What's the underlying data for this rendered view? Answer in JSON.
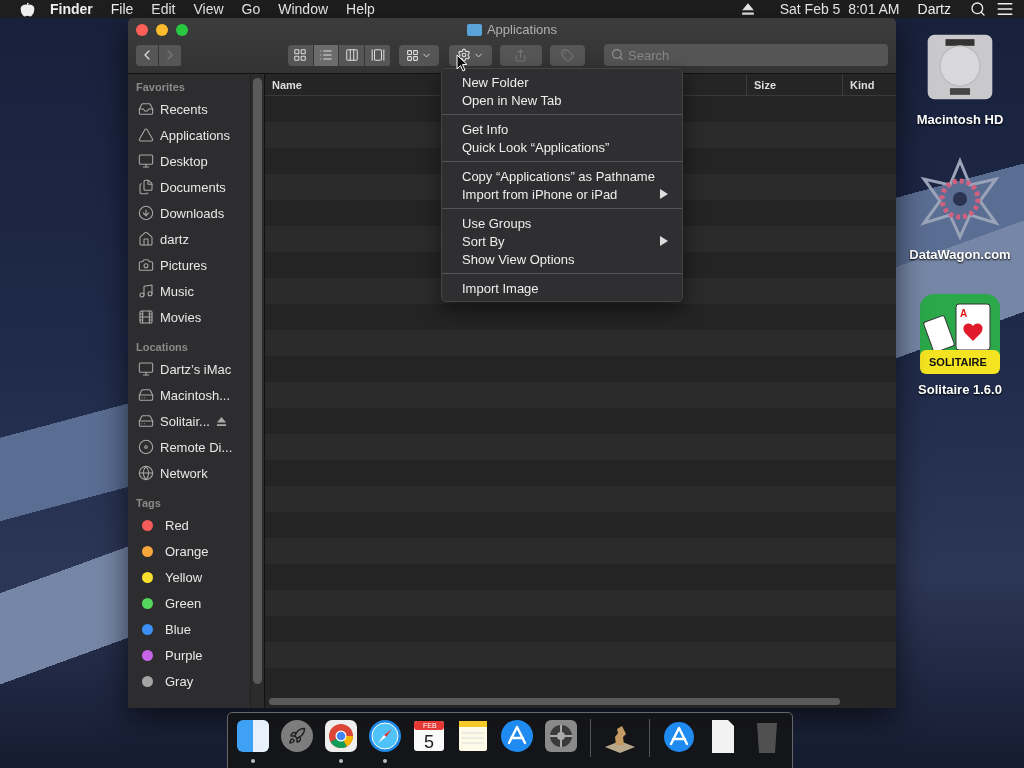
{
  "menubar": {
    "app": "Finder",
    "menus": [
      "File",
      "Edit",
      "View",
      "Go",
      "Window",
      "Help"
    ],
    "clock": "Sat Feb 5  8:01 AM",
    "user": "Dartz"
  },
  "window": {
    "title": "Applications",
    "toolbar": {
      "views": [
        {
          "kind": "icons",
          "selected": false
        },
        {
          "kind": "list",
          "selected": true
        },
        {
          "kind": "columns",
          "selected": false
        },
        {
          "kind": "gallery",
          "selected": false
        }
      ],
      "share_disabled": true,
      "tags_disabled": true,
      "search": {
        "placeholder": "Search"
      }
    },
    "sidebar": [
      {
        "heading": "Favorites",
        "items": [
          {
            "label": "Recents",
            "kind": "recents"
          },
          {
            "label": "Applications",
            "kind": "applications"
          },
          {
            "label": "Desktop",
            "kind": "desktop"
          },
          {
            "label": "Documents",
            "kind": "documents"
          },
          {
            "label": "Downloads",
            "kind": "downloads"
          },
          {
            "label": "dartz",
            "kind": "home"
          },
          {
            "label": "Pictures",
            "kind": "pictures"
          },
          {
            "label": "Music",
            "kind": "music"
          },
          {
            "label": "Movies",
            "kind": "movies"
          }
        ]
      },
      {
        "heading": "Locations",
        "items": [
          {
            "label": "Dartz’s iMac",
            "kind": "computer"
          },
          {
            "label": "Macintosh...",
            "kind": "disk"
          },
          {
            "label": "Solitair...",
            "kind": "volume",
            "ejectable": true
          },
          {
            "label": "Remote Di...",
            "kind": "disc"
          },
          {
            "label": "Network",
            "kind": "network"
          }
        ]
      },
      {
        "heading": "Tags",
        "items": [
          {
            "label": "Red",
            "kind": "tag",
            "color": "#f45b5b"
          },
          {
            "label": "Orange",
            "kind": "tag",
            "color": "#f5a73b"
          },
          {
            "label": "Yellow",
            "kind": "tag",
            "color": "#f7df2e"
          },
          {
            "label": "Green",
            "kind": "tag",
            "color": "#53d85c"
          },
          {
            "label": "Blue",
            "kind": "tag",
            "color": "#3b8ff5"
          },
          {
            "label": "Purple",
            "kind": "tag",
            "color": "#c763e6"
          },
          {
            "label": "Gray",
            "kind": "tag",
            "color": "#a5a5a5"
          }
        ]
      }
    ],
    "columns": [
      {
        "label": "Name"
      },
      {
        "label": "Size"
      },
      {
        "label": "Kind"
      }
    ]
  },
  "context_menu": [
    [
      {
        "label": "New Folder",
        "submenu": false
      },
      {
        "label": "Open in New Tab",
        "submenu": false
      }
    ],
    [
      {
        "label": "Get Info",
        "submenu": false
      },
      {
        "label": "Quick Look “Applications”",
        "submenu": false
      }
    ],
    [
      {
        "label": "Copy “Applications” as Pathname",
        "submenu": false
      },
      {
        "label": "Import from iPhone or iPad",
        "submenu": true
      }
    ],
    [
      {
        "label": "Use Groups",
        "submenu": false
      },
      {
        "label": "Sort By",
        "submenu": true
      },
      {
        "label": "Show View Options",
        "submenu": false
      }
    ],
    [
      {
        "label": "Import Image",
        "submenu": false
      }
    ]
  ],
  "desktop_icons": [
    {
      "label": "Macintosh HD",
      "kind": "harddisk"
    },
    {
      "label": "DataWagon.com",
      "kind": "star"
    },
    {
      "label": "Solitaire 1.6.0",
      "kind": "solitaire",
      "badge": "SOLITAIRE",
      "card": "A"
    }
  ],
  "dock": [
    {
      "kind": "finder",
      "running": true
    },
    {
      "kind": "launchpad"
    },
    {
      "kind": "chrome",
      "running": true
    },
    {
      "kind": "safari",
      "running": true
    },
    {
      "kind": "calendar",
      "month": "FEB",
      "day": "5"
    },
    {
      "kind": "notes"
    },
    {
      "kind": "appstore"
    },
    {
      "kind": "preferences"
    },
    {
      "kind": "separator"
    },
    {
      "kind": "chess"
    },
    {
      "kind": "separator"
    },
    {
      "kind": "downloads"
    },
    {
      "kind": "document"
    },
    {
      "kind": "trash"
    }
  ]
}
